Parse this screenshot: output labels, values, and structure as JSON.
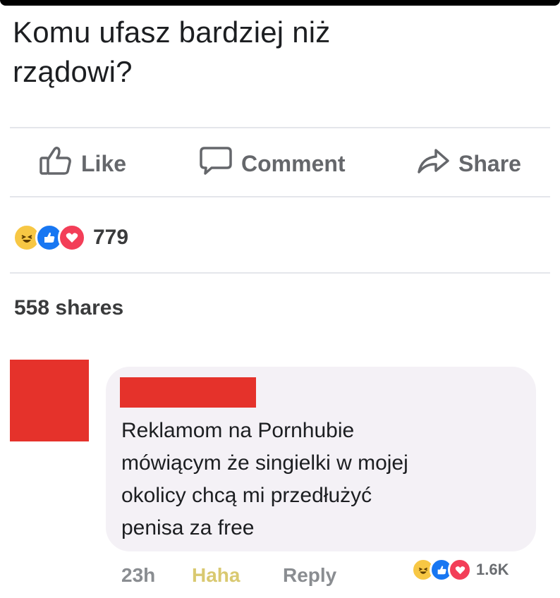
{
  "post": {
    "text_line1": "Komu ufasz bardziej niż",
    "text_line2": "rządowi?"
  },
  "actions": {
    "like_label": "Like",
    "comment_label": "Comment",
    "share_label": "Share"
  },
  "reactions": {
    "icons": [
      "haha-icon",
      "like-icon",
      "love-icon"
    ],
    "count": "779"
  },
  "shares_text": "558 shares",
  "comment": {
    "text_line1": "Reklamom na Pornhubie",
    "text_line2": "mówiącym że singielki w mojej",
    "text_line3": "okolicy chcą mi przedłużyć",
    "text_line4": "penisa za free",
    "time": "23h",
    "haha_label": "Haha",
    "reply_label": "Reply",
    "reaction_count": "1.6K"
  },
  "colors": {
    "redaction": "#e5322b",
    "like_blue": "#1877f2",
    "love_red": "#f33e58",
    "haha_yellow": "#f7c744"
  }
}
